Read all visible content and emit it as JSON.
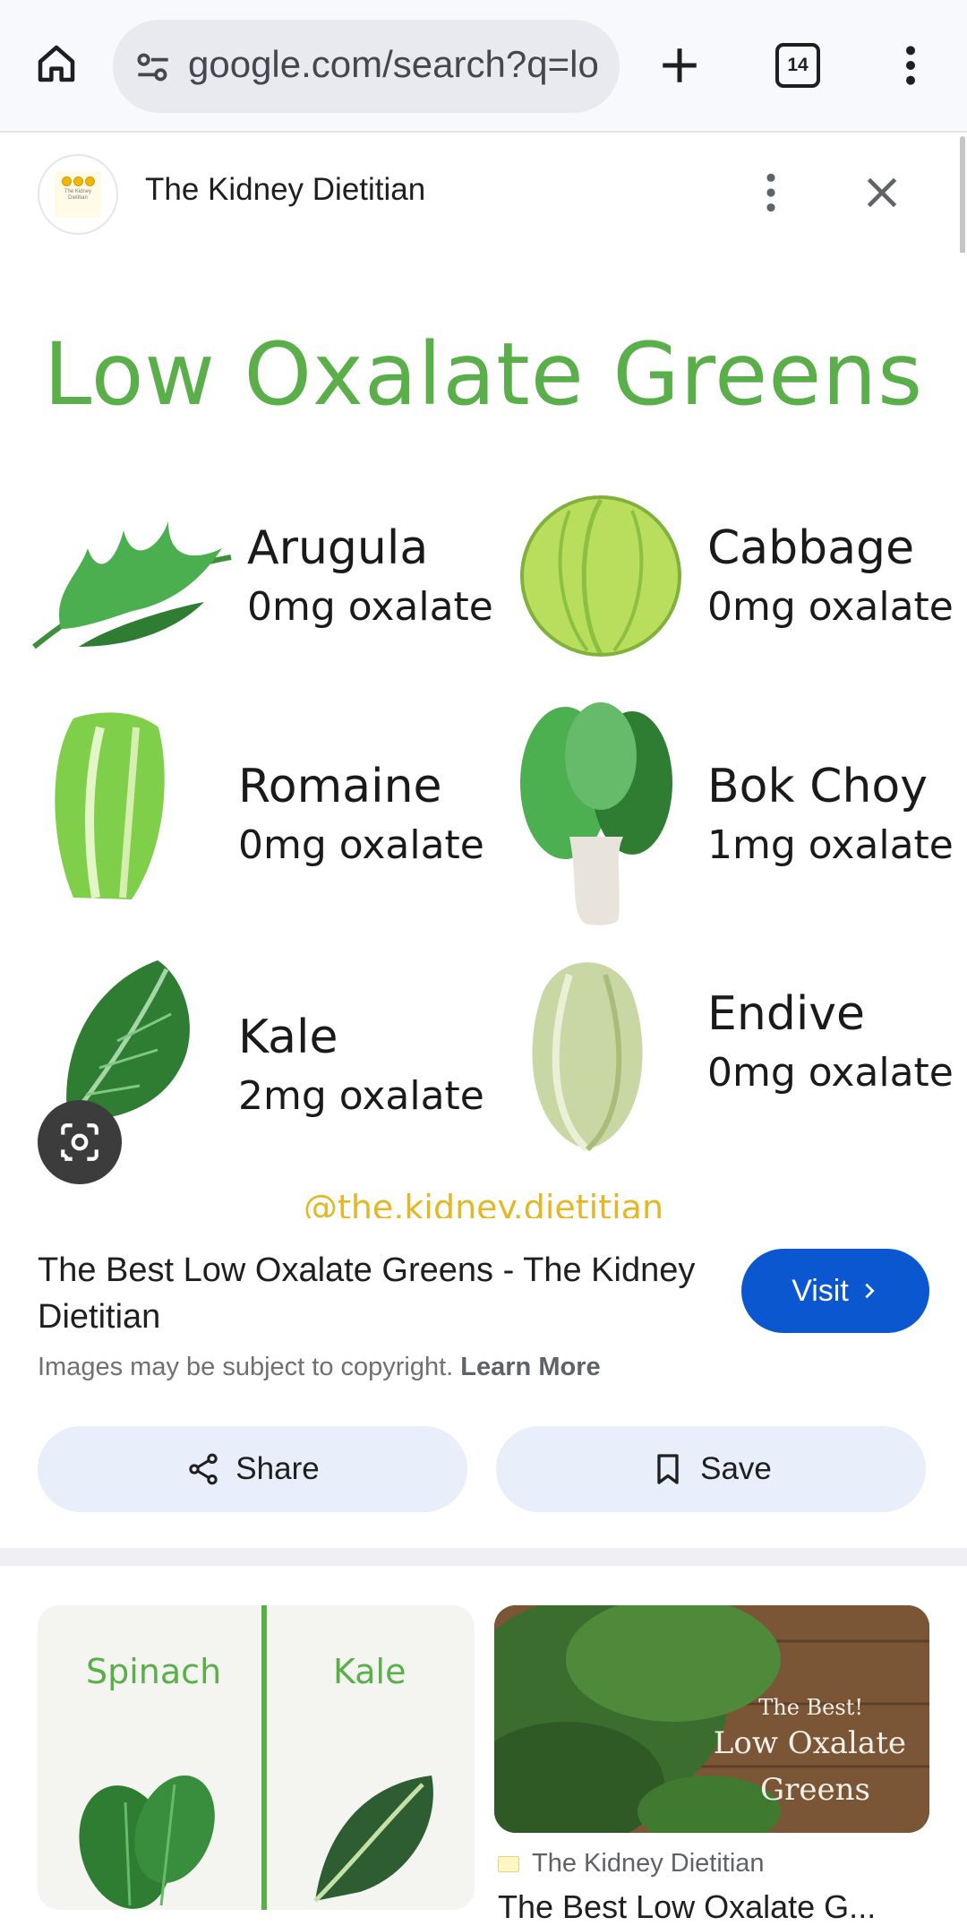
{
  "browser": {
    "url": "google.com/search?q=lo",
    "tab_count": "14"
  },
  "source": {
    "name": "The Kidney Dietitian",
    "favicon_text": "The Kidney Dietitian"
  },
  "image": {
    "title": "Low Oxalate Greens",
    "items": [
      {
        "name": "Arugula",
        "value": "0mg oxalate",
        "icon": "arugula-leaf-icon"
      },
      {
        "name": "Cabbage",
        "value": "0mg oxalate",
        "icon": "cabbage-icon"
      },
      {
        "name": "Romaine",
        "value": "0mg oxalate",
        "icon": "romaine-icon"
      },
      {
        "name": "Bok Choy",
        "value": "1mg oxalate",
        "icon": "bok-choy-icon"
      },
      {
        "name": "Kale",
        "value": "2mg oxalate",
        "icon": "kale-leaf-icon"
      },
      {
        "name": "Endive",
        "value": "0mg oxalate",
        "icon": "endive-icon"
      }
    ],
    "handle": "@the.kidney.dietitian"
  },
  "result": {
    "title": "The Best Low Oxalate Greens - The Kidney Dietitian",
    "visit_label": "Visit",
    "copyright_text": "Images may be subject to copyright.",
    "learn_more": "Learn More",
    "share_label": "Share",
    "save_label": "Save"
  },
  "related": {
    "card1": {
      "left_label": "Spinach",
      "right_label": "Kale"
    },
    "card2": {
      "overlay_line1": "The Best!",
      "overlay_line2": "Low Oxalate",
      "overlay_line3": "Greens",
      "source": "The Kidney Dietitian",
      "title_partial": "The Best Low Oxalate G..."
    }
  },
  "colors": {
    "accent_green": "#5aaf4a",
    "visit_blue": "#0b57d0",
    "handle_gold": "#e5b626",
    "button_bg": "#e9eefb"
  }
}
